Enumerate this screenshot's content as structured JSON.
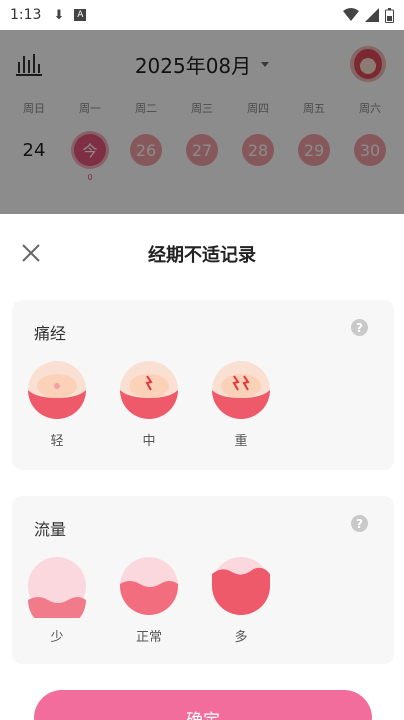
{
  "status_bar": {
    "time": "1:13",
    "icons": [
      "download-icon",
      "a-icon",
      "wifi-icon",
      "signal-icon",
      "battery-icon"
    ]
  },
  "calendar": {
    "month_title": "2025年08月",
    "weekdays": [
      "周日",
      "周一",
      "周二",
      "周三",
      "周四",
      "周五",
      "周六"
    ],
    "days": [
      {
        "label": "24",
        "style": "plain"
      },
      {
        "label": "今",
        "style": "today",
        "dot": "0"
      },
      {
        "label": "26",
        "style": "period"
      },
      {
        "label": "27",
        "style": "period"
      },
      {
        "label": "28",
        "style": "period"
      },
      {
        "label": "29",
        "style": "period"
      },
      {
        "label": "30",
        "style": "period"
      }
    ]
  },
  "sheet": {
    "title": "经期不适记录",
    "pain": {
      "label": "痛经",
      "help": "?",
      "options": [
        {
          "label": "轻",
          "icon": "mild-cramp-icon"
        },
        {
          "label": "中",
          "icon": "moderate-cramp-icon"
        },
        {
          "label": "重",
          "icon": "severe-cramp-icon"
        }
      ]
    },
    "flow": {
      "label": "流量",
      "help": "?",
      "options": [
        {
          "label": "少",
          "icon": "light-flow-icon"
        },
        {
          "label": "正常",
          "icon": "normal-flow-icon"
        },
        {
          "label": "多",
          "icon": "heavy-flow-icon"
        }
      ]
    },
    "confirm_label": "确定"
  },
  "colors": {
    "accent": "#f26d9b",
    "period": "#f4a0a8",
    "today": "#e8577a",
    "card_bg": "#f7f7f7"
  }
}
